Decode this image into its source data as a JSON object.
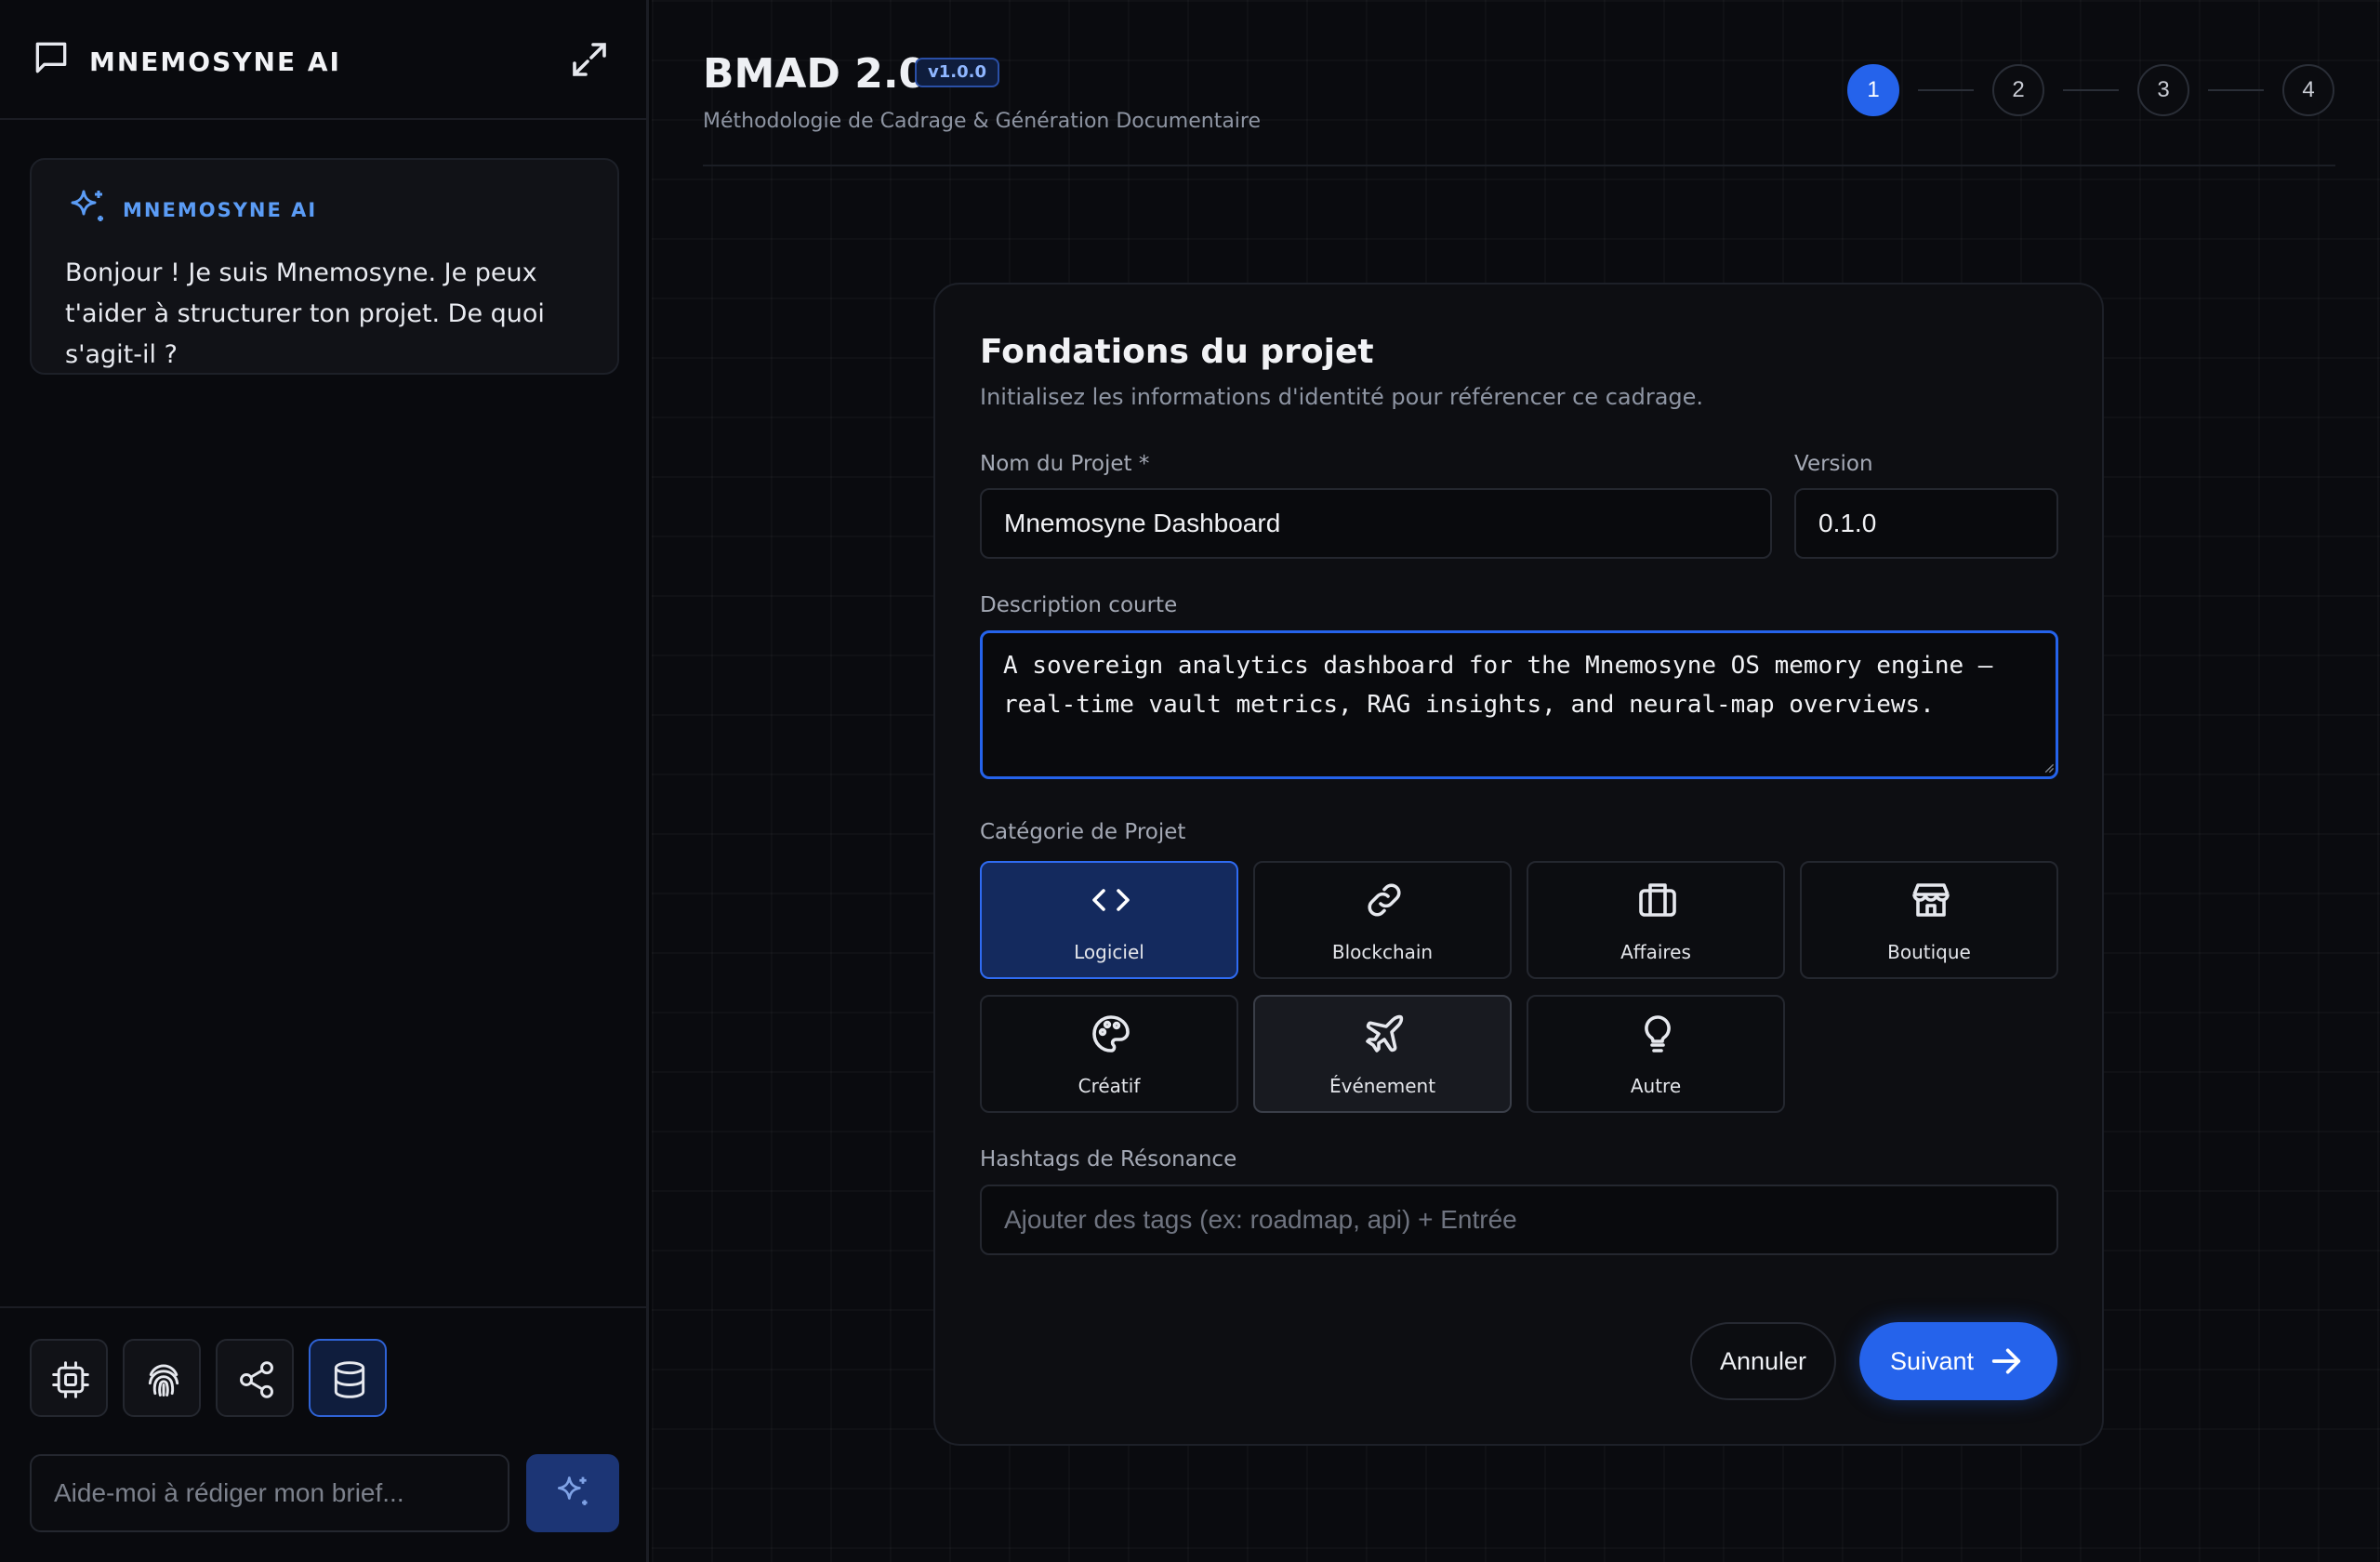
{
  "sidebar": {
    "title": "MNEMOSYNE AI",
    "assistant_card": {
      "label": "MNEMOSYNE AI",
      "message": "Bonjour ! Je suis Mnemosyne. Je peux t'aider à structurer ton projet. De quoi s'agit-il ?"
    },
    "tools": [
      {
        "icon": "cpu-icon",
        "active": false
      },
      {
        "icon": "fingerprint-icon",
        "active": false
      },
      {
        "icon": "share-icon",
        "active": false
      },
      {
        "icon": "database-icon",
        "active": true
      }
    ],
    "prompt": {
      "placeholder": "Aide-moi à rédiger mon brief...",
      "value": ""
    }
  },
  "header": {
    "title": "BMAD 2.0",
    "version_badge": "v1.0.0",
    "subtitle": "Méthodologie de Cadrage & Génération Documentaire",
    "steps": [
      "1",
      "2",
      "3",
      "4"
    ],
    "active_step": 1
  },
  "form": {
    "title": "Fondations du projet",
    "subtitle": "Initialisez les informations d'identité pour référencer ce cadrage.",
    "project_name": {
      "label": "Nom du Projet *",
      "value": "Mnemosyne Dashboard"
    },
    "version": {
      "label": "Version",
      "value": "0.1.0"
    },
    "description": {
      "label": "Description courte",
      "value": "A sovereign analytics dashboard for the Mnemosyne OS memory engine — real-time vault metrics, RAG insights, and neural-map overviews."
    },
    "category": {
      "label": "Catégorie de Projet",
      "selected": "Logiciel",
      "options": [
        {
          "label": "Logiciel",
          "icon": "code-icon"
        },
        {
          "label": "Blockchain",
          "icon": "link-icon"
        },
        {
          "label": "Affaires",
          "icon": "briefcase-icon"
        },
        {
          "label": "Boutique",
          "icon": "store-icon"
        },
        {
          "label": "Créatif",
          "icon": "palette-icon"
        },
        {
          "label": "Événement",
          "icon": "plane-icon"
        },
        {
          "label": "Autre",
          "icon": "lightbulb-icon"
        }
      ]
    },
    "hashtags": {
      "label": "Hashtags de Résonance",
      "placeholder": "Ajouter des tags (ex: roadmap, api) + Entrée",
      "value": ""
    },
    "cancel_label": "Annuler",
    "next_label": "Suivant"
  },
  "colors": {
    "accent": "#2563eb",
    "accent_text": "#5b9cf6",
    "background": "#0a0b0f",
    "card": "#0d0e12"
  }
}
